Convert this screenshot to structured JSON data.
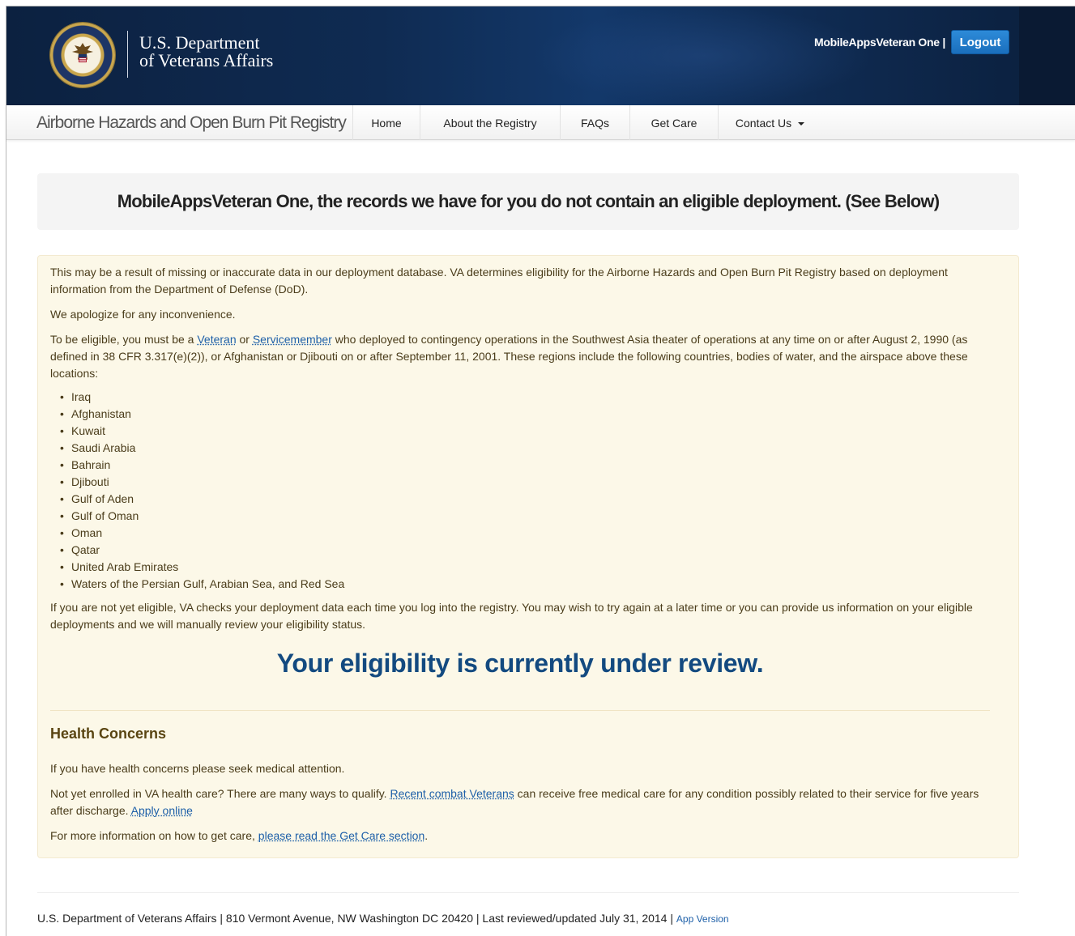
{
  "header": {
    "department_line1": "U.S. Department",
    "department_line2": "of Veterans Affairs",
    "user_label": "MobileAppsVeteran One |",
    "logout_label": "Logout"
  },
  "nav": {
    "brand": "Airborne Hazards and Open Burn Pit Registry",
    "items": [
      {
        "label": "Home"
      },
      {
        "label": "About the Registry"
      },
      {
        "label": "FAQs"
      },
      {
        "label": "Get Care"
      },
      {
        "label": "Contact Us"
      }
    ]
  },
  "main": {
    "title": "MobileAppsVeteran One, the records we have for you do not contain an eligible deployment. (See Below)",
    "para1": "This may be a result of missing or inaccurate data in our deployment database. VA determines eligibility for the Airborne Hazards and Open Burn Pit Registry based on deployment information from the Department of Defense (DoD).",
    "para2": "We apologize for any inconvenience.",
    "para3_prefix": "To be eligible, you must be a ",
    "para3_link1": "Veteran",
    "para3_mid": " or ",
    "para3_link2": "Servicemember",
    "para3_suffix": " who deployed to contingency operations in the Southwest Asia theater of operations at any time on or after August 2, 1990 (as defined in 38 CFR 3.317(e)(2)), or Afghanistan or Djibouti on or after September 11, 2001. These regions include the following countries, bodies of water, and the airspace above these locations:",
    "countries": [
      "Iraq",
      "Afghanistan",
      "Kuwait",
      "Saudi Arabia",
      "Bahrain",
      "Djibouti",
      "Gulf of Aden",
      "Gulf of Oman",
      "Oman",
      "Qatar",
      "United Arab Emirates",
      "Waters of the Persian Gulf, Arabian Sea, and Red Sea"
    ],
    "para4": "If you are not yet eligible, VA checks your deployment data each time you log into the registry. You may wish to try again at a later time or you can provide us information on your eligible deployments and we will manually review your eligibility status.",
    "review_status": "Your eligibility is currently under review.",
    "health_heading": "Health Concerns",
    "health_p1": "If you have health concerns please seek medical attention.",
    "health_p2_prefix": "Not yet enrolled in VA health care? There are many ways to qualify. ",
    "health_p2_link": "Recent combat Veterans",
    "health_p2_mid": " can receive free medical care for any condition possibly related to their service for five years after discharge. ",
    "health_p2_link2": "Apply online",
    "health_p3_prefix": "For more information on how to get care, ",
    "health_p3_link": "please read the Get Care section",
    "health_p3_suffix": "."
  },
  "footer": {
    "text": "U.S. Department of Veterans Affairs | 810 Vermont Avenue, NW Washington DC 20420 | Last reviewed/updated July 31, 2014 | ",
    "app_version": "App Version"
  },
  "colors": {
    "header_bg": "#0f2b52",
    "logout_btn": "#1a6fbd",
    "alert_bg": "#fcf8e8",
    "review_text": "#134a80",
    "link": "#1d5fa8"
  }
}
